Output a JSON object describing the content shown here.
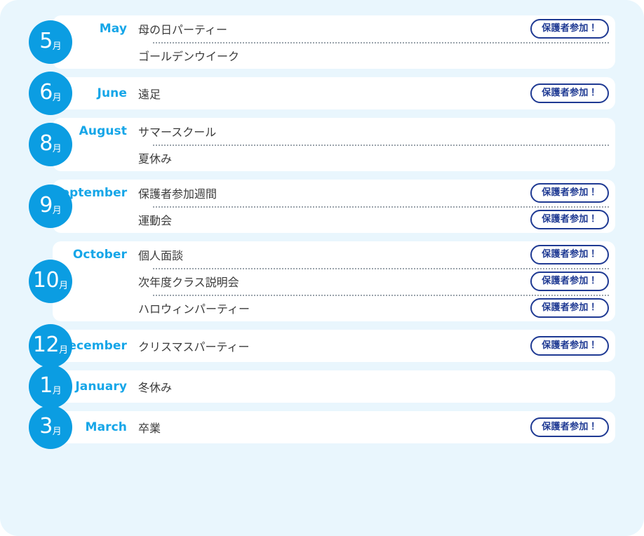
{
  "theme": {
    "panel_background": "#e9f6fd",
    "card_background": "#ffffff",
    "circle_color": "#0b9de2",
    "month_name_color": "#16a6e8",
    "event_text_color": "#3a3a3a",
    "badge_color": "#1f3a93",
    "separator_color": "#9aa3ab"
  },
  "badge": {
    "label": "保護者参加！"
  },
  "month_suffix": "月",
  "months": [
    {
      "number": "5",
      "name_en": "May",
      "events": [
        {
          "title": "母の日パーティー",
          "parent_participation": true
        },
        {
          "title": "ゴールデンウイーク",
          "parent_participation": false
        }
      ]
    },
    {
      "number": "6",
      "name_en": "June",
      "events": [
        {
          "title": "遠足",
          "parent_participation": true
        }
      ]
    },
    {
      "number": "8",
      "name_en": "August",
      "events": [
        {
          "title": "サマースクール",
          "parent_participation": false
        },
        {
          "title": "夏休み",
          "parent_participation": false
        }
      ]
    },
    {
      "number": "9",
      "name_en": "September",
      "events": [
        {
          "title": "保護者参加週間",
          "parent_participation": true
        },
        {
          "title": "運動会",
          "parent_participation": true
        }
      ]
    },
    {
      "number": "10",
      "name_en": "October",
      "events": [
        {
          "title": "個人面談",
          "parent_participation": true
        },
        {
          "title": "次年度クラス説明会",
          "parent_participation": true
        },
        {
          "title": "ハロウィンパーティー",
          "parent_participation": true
        }
      ]
    },
    {
      "number": "12",
      "name_en": "December",
      "events": [
        {
          "title": "クリスマスパーティー",
          "parent_participation": true
        }
      ]
    },
    {
      "number": "1",
      "name_en": "January",
      "events": [
        {
          "title": "冬休み",
          "parent_participation": false
        }
      ]
    },
    {
      "number": "3",
      "name_en": "March",
      "events": [
        {
          "title": "卒業",
          "parent_participation": true
        }
      ]
    }
  ]
}
